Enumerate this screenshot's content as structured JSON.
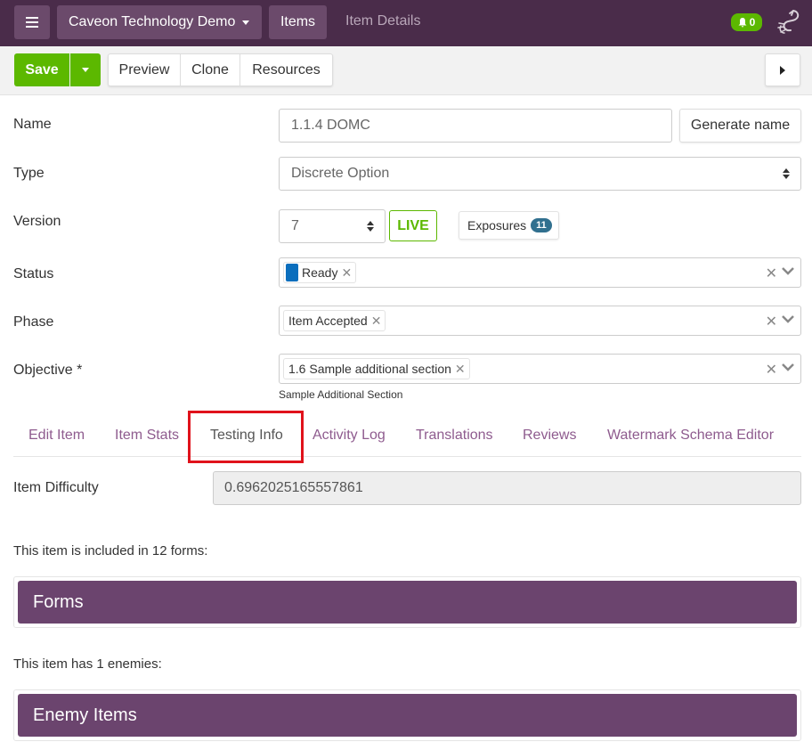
{
  "nav": {
    "menu_icon": "hamburger-icon",
    "org": "Caveon Technology Demo",
    "items": "Items",
    "current": "Item Details",
    "notifications": "0",
    "bell_icon": "bell-icon",
    "logo_icon": "scorpion-logo-icon"
  },
  "toolbar": {
    "save": "Save",
    "preview": "Preview",
    "clone": "Clone",
    "resources": "Resources"
  },
  "form": {
    "name_label": "Name",
    "name_value": "1.1.4 DOMC",
    "generate": "Generate name",
    "type_label": "Type",
    "type_value": "Discrete Option",
    "version_label": "Version",
    "version_value": "7",
    "live": "LIVE",
    "exposures": "Exposures",
    "exposures_count": "11",
    "status_label": "Status",
    "status_value": "Ready",
    "status_color": "#0a6ebd",
    "phase_label": "Phase",
    "phase_value": "Item Accepted",
    "objective_label": "Objective *",
    "objective_value": "1.6 Sample additional section",
    "objective_help": "Sample Additional Section"
  },
  "tabs": [
    {
      "label": "Edit Item"
    },
    {
      "label": "Item Stats"
    },
    {
      "label": "Testing Info"
    },
    {
      "label": "Activity Log"
    },
    {
      "label": "Translations"
    },
    {
      "label": "Reviews"
    },
    {
      "label": "Watermark Schema Editor"
    }
  ],
  "testing": {
    "difficulty_label": "Item Difficulty",
    "difficulty_value": "0.6962025165557861",
    "forms_text": "This item is included in 12 forms:",
    "forms_header": "Forms",
    "enemies_text": "This item has 1 enemies:",
    "enemies_header": "Enemy Items"
  },
  "colors": {
    "nav_bg": "#4a2c4a",
    "accent_green": "#5cb800",
    "tab_link": "#8e5b8e",
    "panel_header": "#6b446e",
    "highlight": "#e0121b"
  }
}
